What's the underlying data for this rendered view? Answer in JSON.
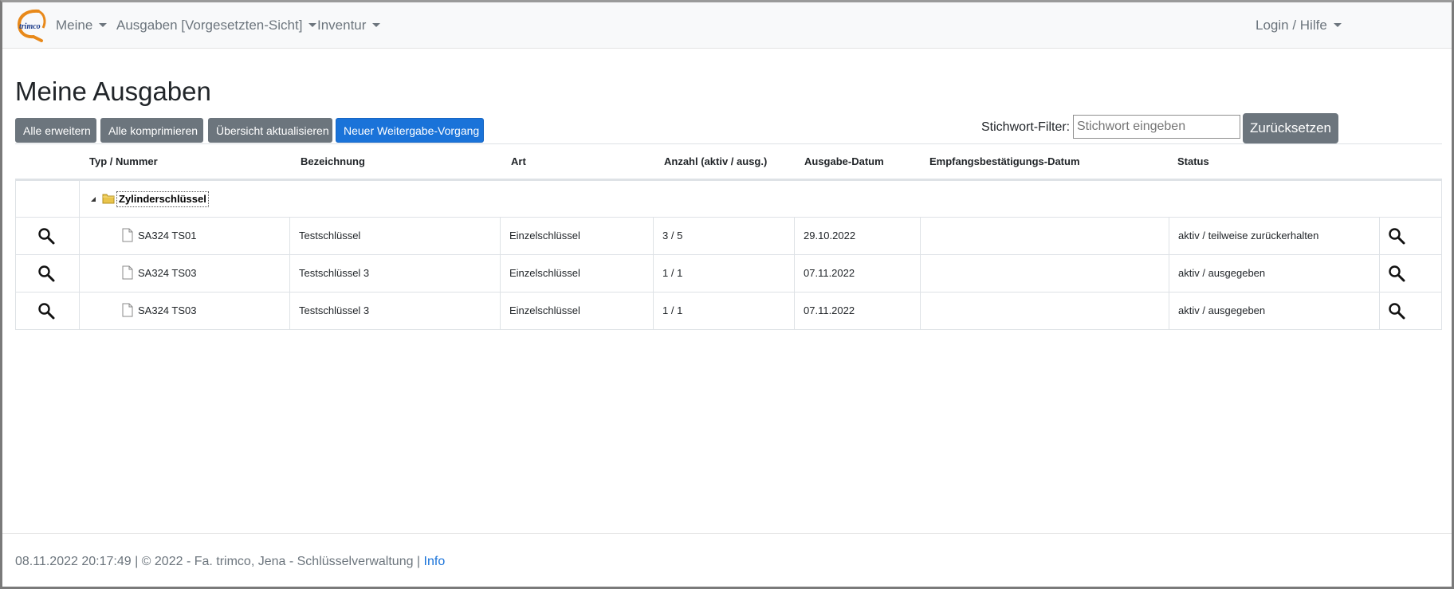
{
  "nav": {
    "items": [
      {
        "label": "Meine"
      },
      {
        "label": "Ausgaben [Vorgesetzten-Sicht]"
      },
      {
        "label": "Inventur"
      }
    ],
    "right_label": "Login / Hilfe",
    "logo_text": "trimco"
  },
  "page": {
    "title": "Meine Ausgaben"
  },
  "toolbar": {
    "expand_all": "Alle erweitern",
    "collapse_all": "Alle komprimieren",
    "refresh": "Übersicht aktualisieren",
    "new_transfer": "Neuer Weitergabe-Vorgang",
    "filter_label": "Stichwort-Filter:",
    "filter_placeholder": "Stichwort eingeben",
    "filter_value": "",
    "reset": "Zurücksetzen"
  },
  "table": {
    "headers": {
      "type_number": "Typ / Nummer",
      "designation": "Bezeichnung",
      "kind": "Art",
      "count": "Anzahl (aktiv / ausg.)",
      "issue_date": "Ausgabe-Datum",
      "receipt_date": "Empfangsbestätigungs-Datum",
      "status": "Status"
    },
    "group": {
      "label": "Zylinderschlüssel"
    },
    "rows": [
      {
        "number": "SA324 TS01",
        "designation": "Testschlüssel",
        "kind": "Einzelschlüssel",
        "count": "3 / 5",
        "issue_date": "29.10.2022",
        "receipt_date": "",
        "status": "aktiv / teilweise zurückerhalten"
      },
      {
        "number": "SA324 TS03",
        "designation": "Testschlüssel 3",
        "kind": "Einzelschlüssel",
        "count": "1 / 1",
        "issue_date": "07.11.2022",
        "receipt_date": "",
        "status": "aktiv / ausgegeben"
      },
      {
        "number": "SA324 TS03",
        "designation": "Testschlüssel 3",
        "kind": "Einzelschlüssel",
        "count": "1 / 1",
        "issue_date": "07.11.2022",
        "receipt_date": "",
        "status": "aktiv / ausgegeben"
      }
    ]
  },
  "footer": {
    "text": "08.11.2022 20:17:49 | © 2022 - Fa. trimco, Jena - Schlüsselverwaltung | ",
    "info_link": "Info"
  },
  "icons": {
    "logo": "trimco-logo-icon",
    "details": "magnifier-icon",
    "folder": "folder-icon",
    "file": "file-icon"
  }
}
